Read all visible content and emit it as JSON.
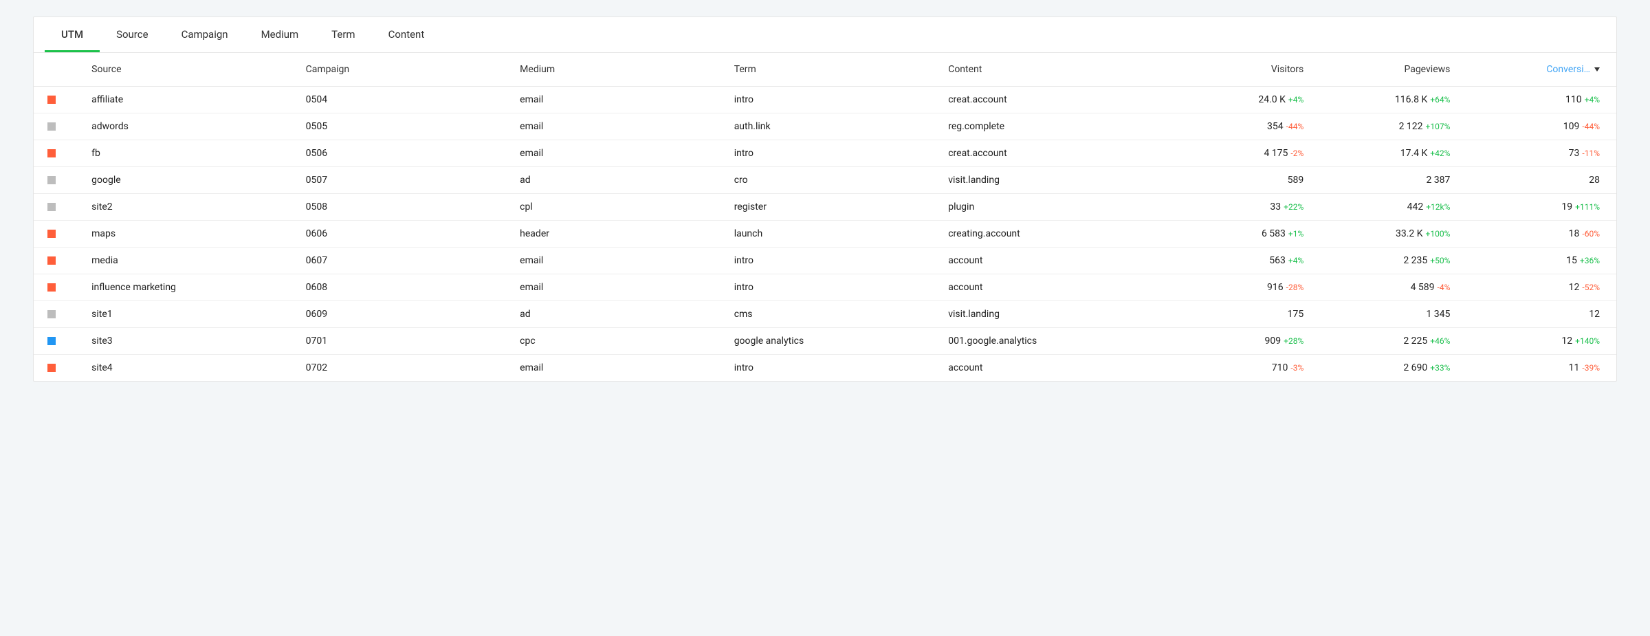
{
  "colors": {
    "orange": "#ff5e3a",
    "grey": "#bdbdbd",
    "blue": "#2196f3"
  },
  "tabs": [
    {
      "label": "UTM",
      "active": true
    },
    {
      "label": "Source",
      "active": false
    },
    {
      "label": "Campaign",
      "active": false
    },
    {
      "label": "Medium",
      "active": false
    },
    {
      "label": "Term",
      "active": false
    },
    {
      "label": "Content",
      "active": false
    }
  ],
  "columns": {
    "source": "Source",
    "campaign": "Campaign",
    "medium": "Medium",
    "term": "Term",
    "content": "Content",
    "visitors": "Visitors",
    "pageviews": "Pageviews",
    "conversions": "Conversi…"
  },
  "rows": [
    {
      "swatch": "orange",
      "source": "affiliate",
      "campaign": "0504",
      "medium": "email",
      "term": "intro",
      "content": "creat.account",
      "visitors": "24.0 K",
      "visitors_delta": "+4%",
      "visitors_sign": "pos",
      "pageviews": "116.8 K",
      "pageviews_delta": "+64%",
      "pageviews_sign": "pos",
      "conversions": "110",
      "conversions_delta": "+4%",
      "conversions_sign": "pos"
    },
    {
      "swatch": "grey",
      "source": "adwords",
      "campaign": "0505",
      "medium": "email",
      "term": "auth.link",
      "content": "reg.complete",
      "visitors": "354",
      "visitors_delta": "-44%",
      "visitors_sign": "neg",
      "pageviews": "2 122",
      "pageviews_delta": "+107%",
      "pageviews_sign": "pos",
      "conversions": "109",
      "conversions_delta": "-44%",
      "conversions_sign": "neg"
    },
    {
      "swatch": "orange",
      "source": "fb",
      "campaign": "0506",
      "medium": "email",
      "term": "intro",
      "content": "creat.account",
      "visitors": "4 175",
      "visitors_delta": "-2%",
      "visitors_sign": "neg",
      "pageviews": "17.4 K",
      "pageviews_delta": "+42%",
      "pageviews_sign": "pos",
      "conversions": "73",
      "conversions_delta": "-11%",
      "conversions_sign": "neg"
    },
    {
      "swatch": "grey",
      "source": "google",
      "campaign": "0507",
      "medium": "ad",
      "term": "cro",
      "content": "visit.landing",
      "visitors": "589",
      "visitors_delta": "",
      "visitors_sign": "",
      "pageviews": "2 387",
      "pageviews_delta": "",
      "pageviews_sign": "",
      "conversions": "28",
      "conversions_delta": "",
      "conversions_sign": ""
    },
    {
      "swatch": "grey",
      "source": "site2",
      "campaign": "0508",
      "medium": "cpl",
      "term": "register",
      "content": "plugin",
      "visitors": "33",
      "visitors_delta": "+22%",
      "visitors_sign": "pos",
      "pageviews": "442",
      "pageviews_delta": "+12k%",
      "pageviews_sign": "pos",
      "conversions": "19",
      "conversions_delta": "+111%",
      "conversions_sign": "pos"
    },
    {
      "swatch": "orange",
      "source": "maps",
      "campaign": "0606",
      "medium": "header",
      "term": "launch",
      "content": "creating.account",
      "visitors": "6 583",
      "visitors_delta": "+1%",
      "visitors_sign": "pos",
      "pageviews": "33.2 K",
      "pageviews_delta": "+100%",
      "pageviews_sign": "pos",
      "conversions": "18",
      "conversions_delta": "-60%",
      "conversions_sign": "neg"
    },
    {
      "swatch": "orange",
      "source": "media",
      "campaign": "0607",
      "medium": "email",
      "term": "intro",
      "content": "account",
      "visitors": "563",
      "visitors_delta": "+4%",
      "visitors_sign": "pos",
      "pageviews": "2 235",
      "pageviews_delta": "+50%",
      "pageviews_sign": "pos",
      "conversions": "15",
      "conversions_delta": "+36%",
      "conversions_sign": "pos"
    },
    {
      "swatch": "orange",
      "source": "influence marketing",
      "campaign": "0608",
      "medium": "email",
      "term": "intro",
      "content": "account",
      "visitors": "916",
      "visitors_delta": "-28%",
      "visitors_sign": "neg",
      "pageviews": "4 589",
      "pageviews_delta": "-4%",
      "pageviews_sign": "neg",
      "conversions": "12",
      "conversions_delta": "-52%",
      "conversions_sign": "neg"
    },
    {
      "swatch": "grey",
      "source": "site1",
      "campaign": "0609",
      "medium": "ad",
      "term": "cms",
      "content": "visit.landing",
      "visitors": "175",
      "visitors_delta": "",
      "visitors_sign": "",
      "pageviews": "1 345",
      "pageviews_delta": "",
      "pageviews_sign": "",
      "conversions": "12",
      "conversions_delta": "",
      "conversions_sign": ""
    },
    {
      "swatch": "blue",
      "source": "site3",
      "campaign": "0701",
      "medium": "cpc",
      "term": "google analytics",
      "content": "001.google.analytics",
      "visitors": "909",
      "visitors_delta": "+28%",
      "visitors_sign": "pos",
      "pageviews": "2 225",
      "pageviews_delta": "+46%",
      "pageviews_sign": "pos",
      "conversions": "12",
      "conversions_delta": "+140%",
      "conversions_sign": "pos"
    },
    {
      "swatch": "orange",
      "source": "site4",
      "campaign": "0702",
      "medium": "email",
      "term": "intro",
      "content": "account",
      "visitors": "710",
      "visitors_delta": "-3%",
      "visitors_sign": "neg",
      "pageviews": "2 690",
      "pageviews_delta": "+33%",
      "pageviews_sign": "pos",
      "conversions": "11",
      "conversions_delta": "-39%",
      "conversions_sign": "neg"
    }
  ]
}
